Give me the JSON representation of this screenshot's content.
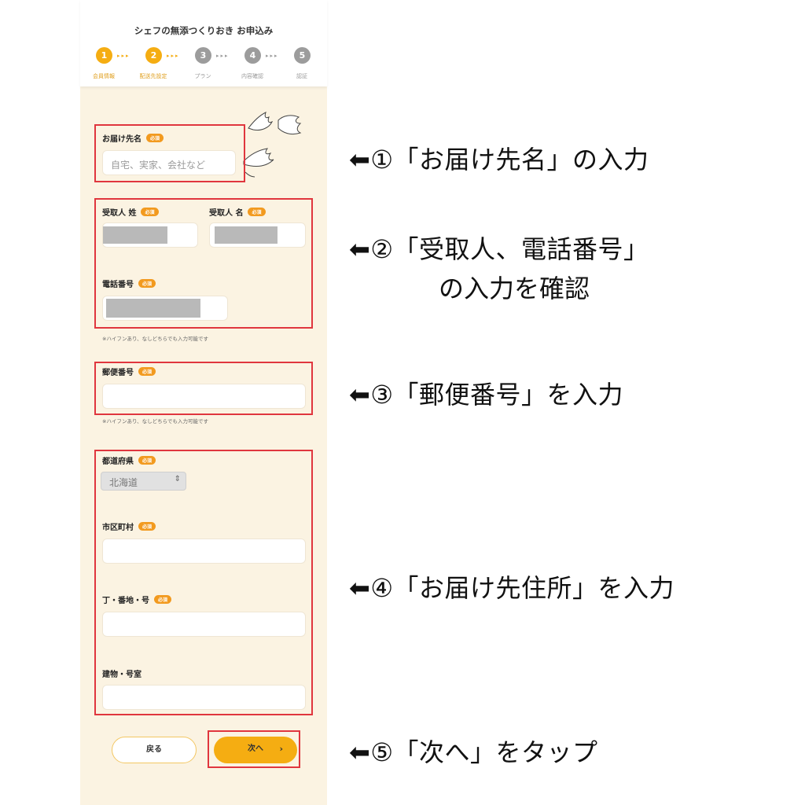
{
  "header": {
    "title": "シェフの無添つくりおき お申込み",
    "steps": [
      {
        "num": "1",
        "label": "会員情報",
        "active": true
      },
      {
        "num": "2",
        "label": "配送先設定",
        "active": true
      },
      {
        "num": "3",
        "label": "プラン",
        "active": false
      },
      {
        "num": "4",
        "label": "内容確認",
        "active": false
      },
      {
        "num": "5",
        "label": "認証",
        "active": false
      }
    ],
    "arrow_glyphs": "▸▸▸"
  },
  "form": {
    "required_badge": "必須",
    "delivery_name": {
      "label": "お届け先名",
      "placeholder": "自宅、実家、会社など"
    },
    "recipient_last": {
      "label": "受取人 姓"
    },
    "recipient_first": {
      "label": "受取人 名"
    },
    "phone": {
      "label": "電話番号",
      "note": "※ハイフンあり、なしどちらでも入力可能です"
    },
    "postal": {
      "label": "郵便番号",
      "note": "※ハイフンあり、なしどちらでも入力可能です"
    },
    "prefecture": {
      "label": "都道府県",
      "value": "北海道"
    },
    "city": {
      "label": "市区町村"
    },
    "street": {
      "label": "丁・番地・号"
    },
    "building": {
      "label": "建物・号室"
    },
    "back_button": "戻る",
    "next_button": "次へ",
    "next_chevron": "›"
  },
  "annotations": {
    "a1": "⬅①「お届け先名」の入力",
    "a2_line1": "⬅②「受取人、電話番号」",
    "a2_line2": "の入力を確認",
    "a3": "⬅③「郵便番号」を入力",
    "a4": "⬅④「お届け先住所」を入力",
    "a5": "⬅⑤「次へ」をタップ"
  },
  "colors": {
    "accent": "#f5ad12",
    "highlight_box": "#e0363e",
    "form_background": "#fbf3e2"
  }
}
